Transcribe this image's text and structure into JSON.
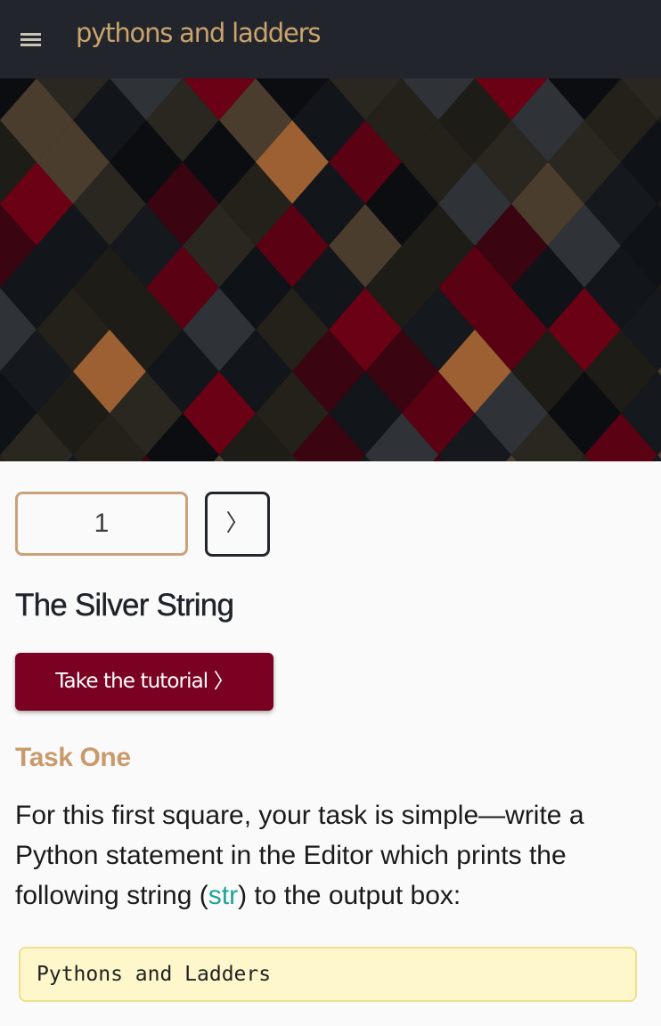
{
  "header": {
    "title": "pythons and ladders",
    "menu_icon": "hamburger-menu-icon"
  },
  "colors": {
    "header_bg": "#22262c",
    "title_color": "#caa36d",
    "button_bg": "#7a0122",
    "heading_color": "#c99a6c",
    "code_ref_color": "#22a39b",
    "code_box_bg": "#fdf7cb"
  },
  "pager": {
    "current_page": "1",
    "next_icon": "chevron-right-icon",
    "next_label": "〉"
  },
  "lesson": {
    "title": "The Silver String",
    "tutorial_button": "Take the tutorial 〉"
  },
  "task": {
    "heading": "Task One",
    "text_before": "For this first square, your task is simple—write a Python statement in the Editor which prints the following string (",
    "code_ref": "str",
    "text_after": ") to the output box:",
    "code": "Pythons and Ladders"
  }
}
